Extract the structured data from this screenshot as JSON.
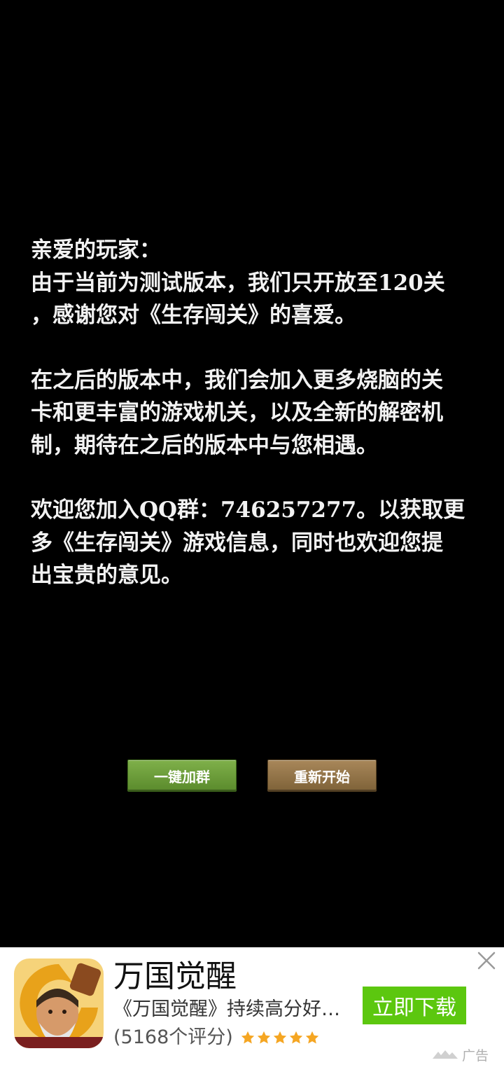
{
  "message": {
    "salutation": "亲爱的玩家：",
    "paragraph1": "由于当前为测试版本，我们只开放至120关\n，感谢您对《生存闯关》的喜爱。",
    "paragraph2": "在之后的版本中，我们会加入更多烧脑的关\n卡和更丰富的游戏机关，以及全新的解密机\n制，期待在之后的版本中与您相遇。",
    "paragraph3": "欢迎您加入QQ群：746257277。以获取更\n多《生存闯关》游戏信息，同时也欢迎您提\n出宝贵的意见。"
  },
  "buttons": {
    "join_label": "一键加群",
    "restart_label": "重新开始"
  },
  "ad": {
    "title": "万国觉醒",
    "description": "《万国觉醒》持续高分好评，精彩内容等你来",
    "rating_text": "(5168个评分)",
    "stars": 5,
    "download_label": "立即下载",
    "badge_label": "广告"
  },
  "colors": {
    "background": "#000000",
    "text": "#f2f2f2",
    "join_button": "#6b9c3a",
    "restart_button": "#957349",
    "download_button": "#5cc70f",
    "star": "#f5a623"
  },
  "icons": {
    "app_icon": "warrior-app-icon",
    "close": "close-icon",
    "star": "star-icon",
    "ad_logo": "ad-logo-icon"
  }
}
